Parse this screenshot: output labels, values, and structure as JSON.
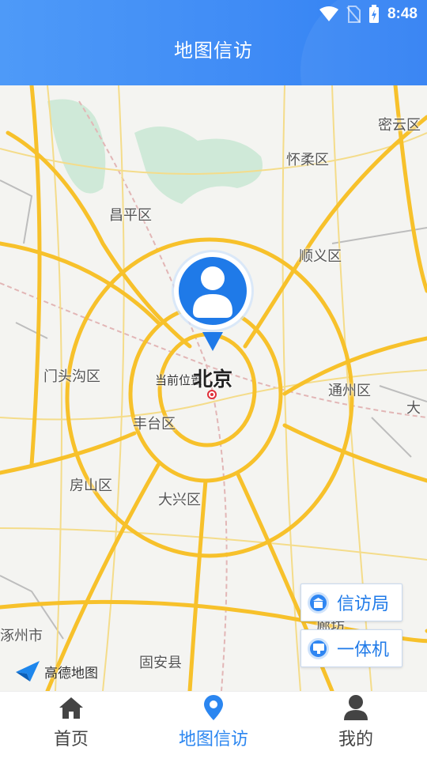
{
  "status_bar": {
    "time": "8:48"
  },
  "header": {
    "title": "地图信访"
  },
  "map": {
    "places": [
      {
        "key": "miyun",
        "label": "密云区"
      },
      {
        "key": "huairou",
        "label": "怀柔区"
      },
      {
        "key": "changping",
        "label": "昌平区"
      },
      {
        "key": "shunyi",
        "label": "顺义区"
      },
      {
        "key": "mentougou",
        "label": "门头沟区"
      },
      {
        "key": "current",
        "label": "当前位置"
      },
      {
        "key": "beijing",
        "label": "北京"
      },
      {
        "key": "tongzhou",
        "label": "通州区"
      },
      {
        "key": "da",
        "label": "大"
      },
      {
        "key": "fengtai",
        "label": "丰台区"
      },
      {
        "key": "fangshan",
        "label": "房山区"
      },
      {
        "key": "daxing",
        "label": "大兴区"
      },
      {
        "key": "zhuozhou",
        "label": "涿州市"
      },
      {
        "key": "langfang",
        "label": "廊坊"
      },
      {
        "key": "gu_an",
        "label": "固安县"
      }
    ],
    "buttons": {
      "petition_bureau": "信访局",
      "kiosk": "一体机"
    },
    "logo_text": "高德地图"
  },
  "tabs": [
    {
      "label": "首页",
      "icon": "home-icon",
      "active": false
    },
    {
      "label": "地图信访",
      "icon": "location-pin-icon",
      "active": true
    },
    {
      "label": "我的",
      "icon": "user-icon",
      "active": false
    }
  ],
  "colors": {
    "accent": "#2b86f0",
    "header": "#3f8bf5",
    "road": "#f7c12b"
  }
}
